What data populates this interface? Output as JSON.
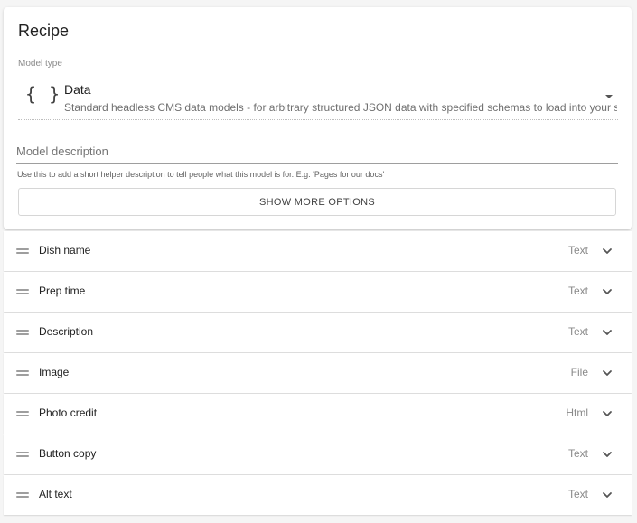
{
  "card": {
    "title": "Recipe",
    "model_type": {
      "label": "Model type",
      "icon": "{ }",
      "icon_name": "braces-icon",
      "name": "Data",
      "description": "Standard headless CMS data models - for arbitrary structured JSON data with specified schemas to load into your site"
    },
    "model_description": {
      "placeholder": "Model description",
      "value": "",
      "help": "Use this to add a short helper description to tell people what this model is for. E.g. 'Pages for our docs'"
    },
    "show_more_label": "SHOW MORE OPTIONS"
  },
  "fields": [
    {
      "name": "Dish name",
      "type": "Text"
    },
    {
      "name": "Prep time",
      "type": "Text"
    },
    {
      "name": "Description",
      "type": "Text"
    },
    {
      "name": "Image",
      "type": "File"
    },
    {
      "name": "Photo credit",
      "type": "Html"
    },
    {
      "name": "Button copy",
      "type": "Text"
    },
    {
      "name": "Alt text",
      "type": "Text"
    }
  ],
  "icons": {
    "drag_handle": "drag-handle-icon",
    "expand": "chevron-down-icon",
    "dropdown": "caret-down-icon"
  }
}
